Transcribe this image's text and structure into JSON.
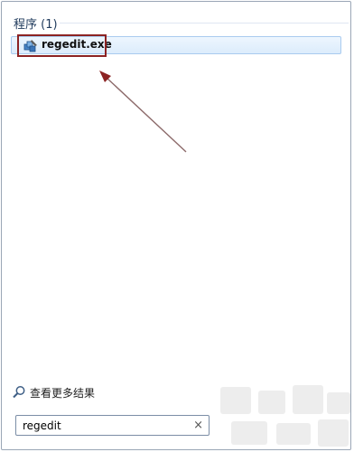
{
  "programs_section": {
    "header": "程序 (1)"
  },
  "results": [
    {
      "label": "regedit.exe",
      "icon": "regedit-icon"
    }
  ],
  "see_more": {
    "label": "查看更多结果",
    "icon": "search-icon"
  },
  "search": {
    "value": "regedit",
    "clear_label": "×"
  },
  "colors": {
    "highlight_box": "#8c2323",
    "arrow": "#8c2323",
    "selected_row": "#dcecfc",
    "section_header": "#1e395b"
  }
}
